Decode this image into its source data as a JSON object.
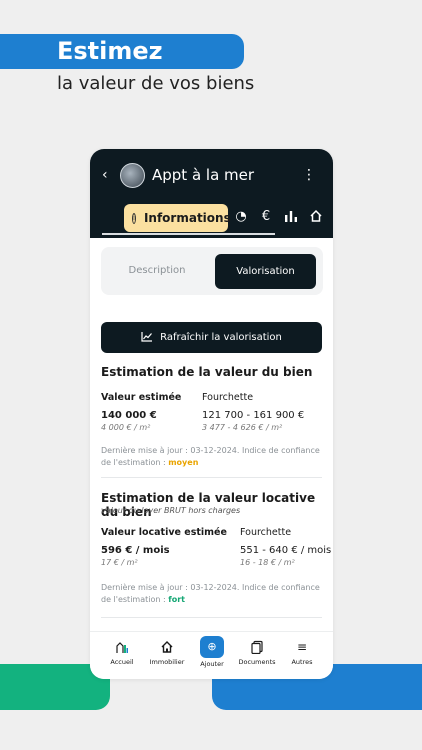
{
  "promo": {
    "title": "Estimez",
    "subtitle": "la valeur de vos biens"
  },
  "header": {
    "back_icon": "chevron-left-icon",
    "title": "Appt à la mer",
    "more_icon": "more-vertical-icon"
  },
  "tabs": {
    "active_label": "Informations",
    "icons": [
      "info-icon",
      "pie-chart-icon",
      "euro-icon",
      "bar-chart-icon",
      "home-icon"
    ]
  },
  "segmented": {
    "description": "Description",
    "valorisation": "Valorisation"
  },
  "refresh_button": "Rafraîchir la valorisation",
  "sale_estimate": {
    "title": "Estimation de la valeur du bien",
    "estimated_label": "Valeur estimée",
    "range_label": "Fourchette",
    "estimated_value": "140 000 €",
    "estimated_per_m2": "4 000 € / m²",
    "range_value": "121 700 - 161 900 €",
    "range_per_m2": "3 477 - 4 626 € / m²",
    "note_prefix": "Dernière mise à jour : 03-12-2024. Indice de confiance de l'estimation : ",
    "confidence": "moyen"
  },
  "rent_estimate": {
    "title": "Estimation de la valeur locative du bien",
    "subtitle": "valeur du loyer BRUT hors charges",
    "estimated_label": "Valeur locative estimée",
    "range_label": "Fourchette",
    "estimated_value": "596 € / mois",
    "estimated_per_m2": "17 € / m²",
    "range_value": "551 - 640 € / mois",
    "range_per_m2": "16 - 18 € / m²",
    "note_prefix": "Dernière mise à jour : 03-12-2024. Indice de confiance de l'estimation : ",
    "confidence": "fort"
  },
  "bottom_nav": [
    {
      "label": "Accueil",
      "icon": "home-city-icon"
    },
    {
      "label": "Immobilier",
      "icon": "house-icon"
    },
    {
      "label": "Ajouter",
      "icon": "plus-circle-icon"
    },
    {
      "label": "Documents",
      "icon": "documents-icon"
    },
    {
      "label": "Autres",
      "icon": "menu-icon"
    }
  ],
  "colors": {
    "accent_blue": "#1e7fd0",
    "accent_green": "#13b27f",
    "dark": "#0d1a21",
    "tab_active": "#fbe0a0",
    "confidence_medium": "#e9a400",
    "confidence_high": "#13a673"
  }
}
